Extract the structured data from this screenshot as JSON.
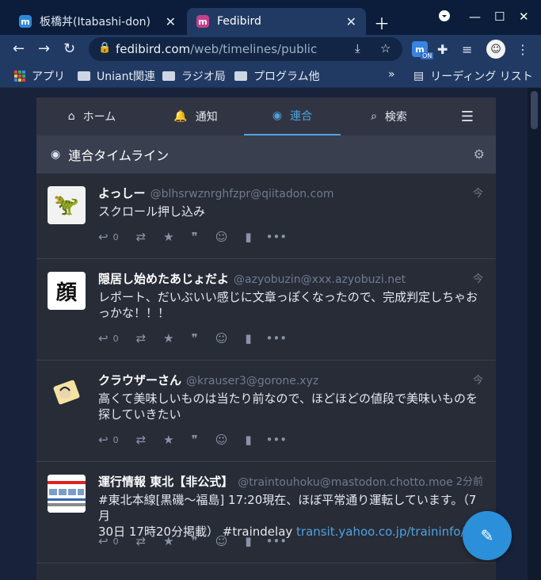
{
  "browser": {
    "tabs": [
      {
        "title": "板橋丼(Itabashi-don)",
        "favicon": "mastodon-favicon"
      },
      {
        "title": "Fedibird",
        "favicon": "misskey-favicon"
      }
    ],
    "url_host": "fedibird.com",
    "url_path": "/web/timelines/public",
    "bookmarks": [
      "アプリ",
      "Uniant関連",
      "ラジオ局",
      "プログラム他"
    ],
    "reading_list": "リーディング リスト",
    "extension_badge": "ON"
  },
  "nav": {
    "home": "ホーム",
    "notifications": "通知",
    "federated": "連合",
    "search": "検索"
  },
  "column": {
    "title": "連合タイムライン"
  },
  "statuses": [
    {
      "display_name": "よっしー",
      "acct": "@blhsrwznrghfzpr@qiitadon.com",
      "time": "今",
      "content_lines": [
        "スクロール押し込み"
      ],
      "replies": "0",
      "avatar_glyph": "🦖"
    },
    {
      "display_name": "隠居し始めたあじょだよ",
      "acct": "@azyobuzin@xxx.azyobuzi.net",
      "time": "今",
      "content_lines": [
        "レポート、だいぶいい感じに文章っぽくなったので、完成判定しちゃお",
        "っかな！！！"
      ],
      "replies": "0",
      "avatar_glyph": "顔"
    },
    {
      "display_name": "クラウザーさん",
      "acct": "@krauser3@gorone.xyz",
      "time": "今",
      "content_lines": [
        "高くて美味しいものは当たり前なので、ほどほどの値段で美味いものを",
        "探していきたい"
      ],
      "replies": "0",
      "avatar_glyph": "☺"
    },
    {
      "display_name": "運行情報 東北【非公式】",
      "acct": "@traintouhoku@mastodon.chotto.moe",
      "time": "2分前",
      "content_lines": [
        "#東北本線[黒磯～福島] 17:20現在、ほぼ平常通り運転しています。（7月",
        "30日 17時20分掲載） #traindelay "
      ],
      "link": "transit.yahoo.co.jp/traininfo/…",
      "replies": "0",
      "avatar_glyph": ""
    }
  ],
  "colors": {
    "accent": "#2b90d9",
    "column_bg": "#282c37",
    "browser_frame": "#0b1d3a"
  }
}
